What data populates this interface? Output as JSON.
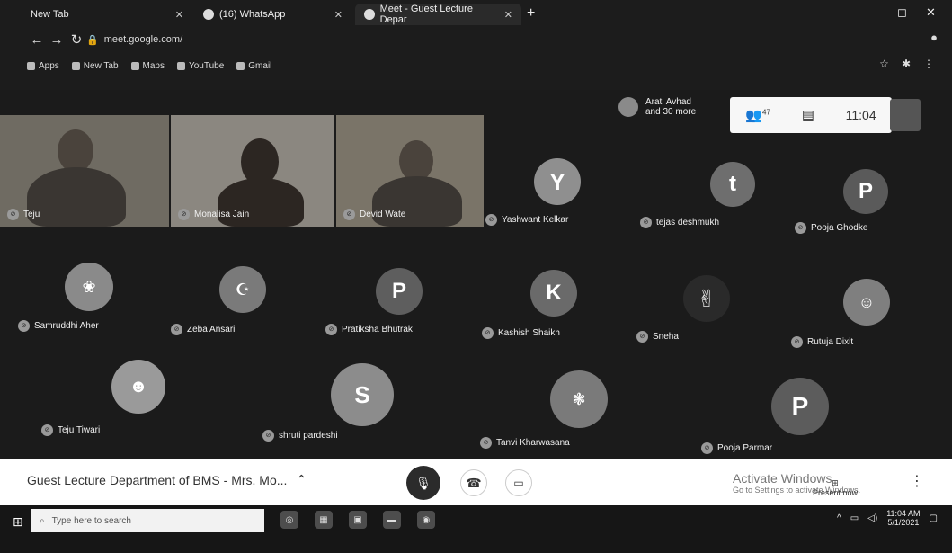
{
  "browser": {
    "tabs": [
      {
        "label": "New Tab",
        "active": false
      },
      {
        "label": "(16) WhatsApp",
        "active": false
      },
      {
        "label": "Meet - Guest Lecture Depar",
        "active": true
      }
    ],
    "new_tab": "+",
    "url": "meet.google.com/",
    "win_min": "–",
    "win_max": "◻",
    "win_close": "✕",
    "bookmarks": [
      "Apps",
      "New Tab",
      "Maps",
      "YouTube",
      "Gmail"
    ]
  },
  "meet": {
    "participants_pill": {
      "line1": "Arati Avhad",
      "line2": "and 30 more"
    },
    "info": {
      "people_count": "47",
      "time": "11:04"
    },
    "video_tiles": [
      "Teju",
      "Monalisa Jain",
      "Devid Wate"
    ],
    "avatar_tiles": [
      {
        "name": "Yashwant Kelkar",
        "letter": "Y",
        "color": "#8f8f8f"
      },
      {
        "name": "tejas deshmukh",
        "letter": "t",
        "color": "#6e6e6e"
      },
      {
        "name": "Pooja Ghodke",
        "letter": "P",
        "color": "#5a5a5a"
      },
      {
        "name": "Samruddhi Aher",
        "letter": "",
        "color": "#8a8a8a"
      },
      {
        "name": "Zeba Ansari",
        "letter": "",
        "color": "#7a7a7a"
      },
      {
        "name": "Pratiksha Bhutrak",
        "letter": "P",
        "color": "#5e5e5e"
      },
      {
        "name": "Kashish Shaikh",
        "letter": "K",
        "color": "#6a6a6a"
      },
      {
        "name": "Sneha",
        "letter": "",
        "color": "#2a2a2a"
      },
      {
        "name": "Rutuja Dixit",
        "letter": "",
        "color": "#7f7f7f"
      },
      {
        "name": "Teju Tiwari",
        "letter": "",
        "color": "#9a9a9a"
      },
      {
        "name": "shruti pardeshi",
        "letter": "S",
        "color": "#8c8c8c"
      },
      {
        "name": "Tanvi Kharwasana",
        "letter": "",
        "color": "#7a7a7a"
      },
      {
        "name": "Pooja Parmar",
        "letter": "P",
        "color": "#5c5c5c"
      }
    ],
    "meeting_title": "Guest Lecture Department of BMS - Mrs. Mo...",
    "activate": {
      "title": "Activate Windows",
      "subtitle": "Go to Settings to activate Windows."
    },
    "present_now": "Present now",
    "more": "⋮"
  },
  "taskbar": {
    "search_placeholder": "Type here to search",
    "time": "11:04 AM",
    "date": "5/1/2021"
  }
}
